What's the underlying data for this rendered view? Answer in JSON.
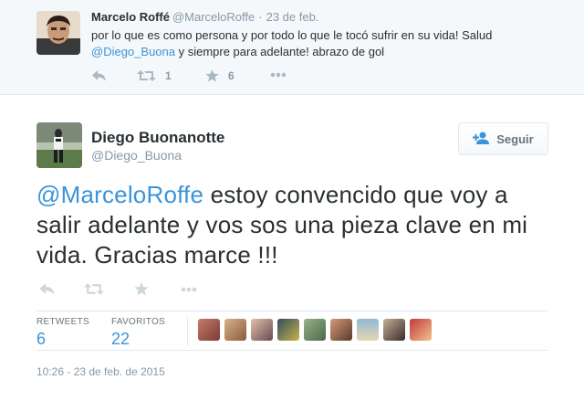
{
  "reply_tweet": {
    "author_name": "Marcelo Roffé",
    "screen_name": "@MarceloRoffe",
    "separator": "·",
    "time": "23 de feb.",
    "text_before": "por lo que es como persona y por todo lo que le tocó sufrir en su vida! Salud ",
    "mention": "@Diego_Buona",
    "text_after": " y siempre para adelante! abrazo de gol",
    "retweet_count": "1",
    "favorite_count": "6"
  },
  "main_tweet": {
    "author_name": "Diego Buonanotte",
    "screen_name": "@Diego_Buona",
    "follow_label": "Seguir",
    "mention": "@MarceloRoffe",
    "text_after": " estoy convencido que voy a salir adelante y vos sos una pieza clave en mi vida. Gracias marce !!!",
    "stats": {
      "retweets_label": "RETWEETS",
      "retweets_value": "6",
      "favorites_label": "FAVORITOS",
      "favorites_value": "22"
    },
    "favoriters_count": 9,
    "timestamp": "10:26 - 23 de feb. de 2015"
  },
  "icons": {
    "reply": "reply-icon",
    "retweet": "retweet-icon",
    "favorite": "star-icon",
    "more": "more-icon",
    "follow": "add-user-icon"
  },
  "colors": {
    "link": "#3b94d9",
    "muted": "#8899a6",
    "text": "#292f33",
    "reply_background": "#f5f8fa",
    "icon": "#ccd6dd"
  }
}
